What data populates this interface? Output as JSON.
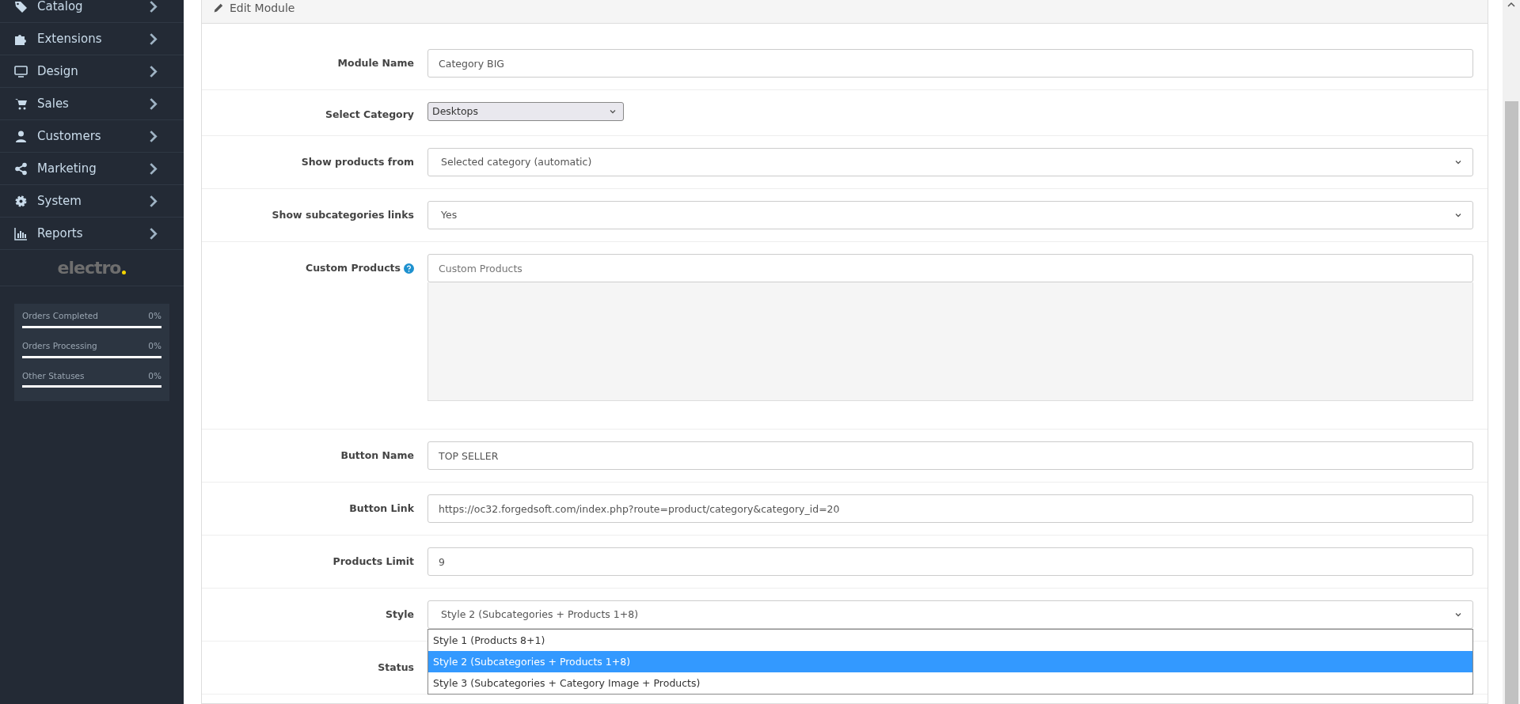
{
  "sidebar": {
    "menu": [
      {
        "label": "Catalog",
        "kind": "tag"
      },
      {
        "label": "Extensions",
        "kind": "puzzle"
      },
      {
        "label": "Design",
        "kind": "monitor"
      },
      {
        "label": "Sales",
        "kind": "cart"
      },
      {
        "label": "Customers",
        "kind": "user"
      },
      {
        "label": "Marketing",
        "kind": "share"
      },
      {
        "label": "System",
        "kind": "gear"
      },
      {
        "label": "Reports",
        "kind": "chart"
      }
    ],
    "logo": "electro",
    "stats": [
      {
        "label": "Orders Completed",
        "value": "0%",
        "level": 0
      },
      {
        "label": "Orders Processing",
        "value": "0%",
        "level": 0
      },
      {
        "label": "Other Statuses",
        "value": "0%",
        "level": 0
      }
    ]
  },
  "panel": {
    "title": "Edit Module",
    "fields": [
      {
        "label": "Module Name",
        "kind": "text",
        "value": "Category BIG"
      },
      {
        "label": "Select Category",
        "kind": "native-select",
        "value": "Desktops"
      },
      {
        "label": "Show products from",
        "kind": "select",
        "value": "Selected category (automatic)"
      },
      {
        "label": "Show subcategories links",
        "kind": "select",
        "value": "Yes"
      },
      {
        "label": "Custom Products",
        "kind": "autocomplete",
        "help": true,
        "placeholder": "Custom Products"
      },
      {
        "label": "Button Name",
        "kind": "text",
        "value": "TOP SELLER"
      },
      {
        "label": "Button Link",
        "kind": "text",
        "value": "https://oc32.forgedsoft.com/index.php?route=product/category&category_id=20"
      },
      {
        "label": "Products Limit",
        "kind": "text",
        "value": "9"
      },
      {
        "label": "Style",
        "kind": "select",
        "value": "Style 2 (Subcategories + Products 1+8)",
        "expanded": true,
        "options": [
          {
            "label": "Style 1 (Products 8+1)",
            "selected": false
          },
          {
            "label": "Style 2 (Subcategories + Products 1+8)",
            "selected": true
          },
          {
            "label": "Style 3 (Subcategories + Category Image + Products)",
            "selected": false
          }
        ]
      },
      {
        "label": "Status",
        "kind": "hidden"
      }
    ]
  }
}
